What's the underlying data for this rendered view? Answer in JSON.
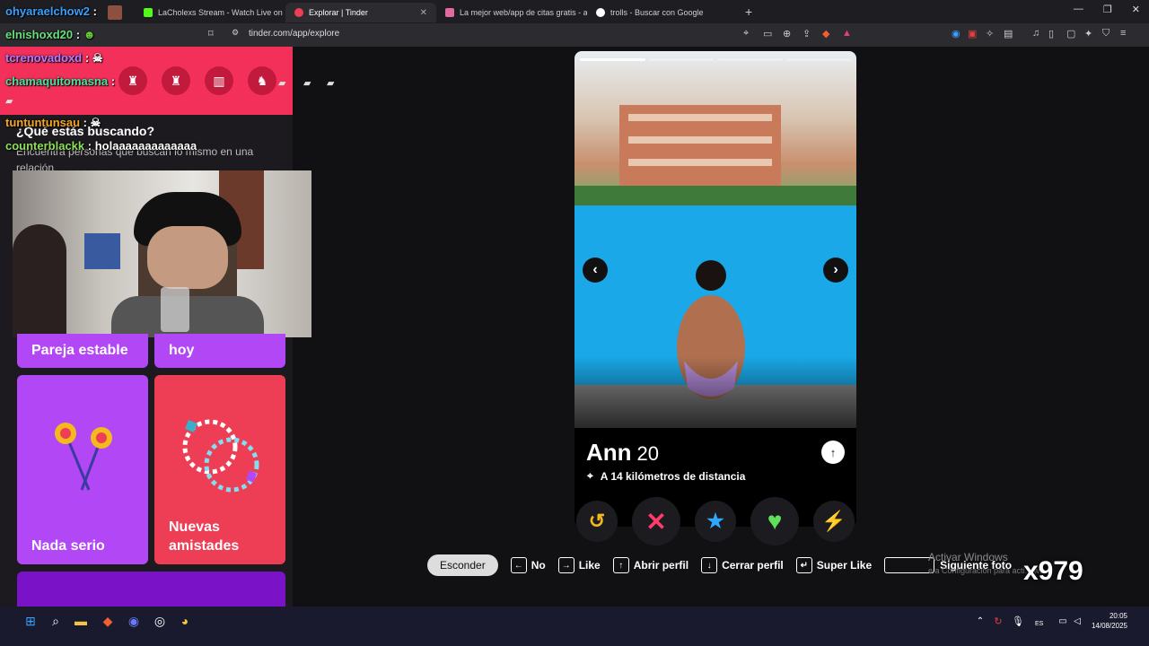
{
  "browser": {
    "tabs": [
      {
        "label": "",
        "active": false
      },
      {
        "label": "LaCholexs Stream - Watch Live on Ki",
        "active": false
      },
      {
        "label": "Explorar | Tinder",
        "active": true
      },
      {
        "label": "La mejor web/app de citas gratis - ar",
        "active": false
      },
      {
        "label": "trolls - Buscar con Google",
        "active": false
      }
    ],
    "new_tab": "+",
    "url": "tinder.com/app/explore"
  },
  "chat": {
    "lines": [
      {
        "user": "ohyaraelchow2",
        "message": ":"
      },
      {
        "user": "elnishoxd20",
        "message": ":"
      },
      {
        "user": "tcrenovadoxd",
        "message": ":"
      },
      {
        "user": "chamaquitomasna",
        "message": ":"
      },
      {
        "user": "tuntuntunsau",
        "message": ":"
      },
      {
        "user": "counterblackk",
        "message": ": holaaaaaaaaaaaaa"
      }
    ],
    "colors": {
      "ohyaraelchow2": "#3aa0ff",
      "elnishoxd20": "#66e07a",
      "tcrenovadoxd": "#b57cff",
      "chamaquitomasna": "#4ee0a0",
      "tuntuntunsau": "#f5a623",
      "counterblackk": "#8ee05a"
    }
  },
  "explore": {
    "heading": "¿Qué estás buscando?",
    "subheading": "Encuentra personas que buscan lo mismo en una relación",
    "cards": [
      {
        "label": "Pareja estable"
      },
      {
        "label": "hoy"
      },
      {
        "label": "Nada serio"
      },
      {
        "label": "Nuevas amistades"
      }
    ]
  },
  "profile": {
    "name": "Ann",
    "age": "20",
    "distance": "A 14 kilómetros de distancia",
    "photo_index": 1,
    "photo_count": 4
  },
  "actions": {
    "rewind": "↺",
    "nope": "✕",
    "superlike": "★",
    "like": "♥",
    "boost": "⚡"
  },
  "shortcuts": {
    "hide": "Esconder",
    "no": "No",
    "like": "Like",
    "open": "Abrir perfil",
    "close": "Cerrar perfil",
    "superlike": "Super Like",
    "next_photo": "Siguiente foto"
  },
  "os": {
    "watermark_title": "Activar Windows",
    "watermark_sub": "e a Configuración para acti... ws.",
    "overlay_logo": "x979",
    "lang": "ES",
    "time": "20:05",
    "date": "14/08/2025"
  },
  "colors": {
    "tinder_red": "#ee3e56",
    "tinder_purple": "#b247f5",
    "stream_banner": "#f2305a",
    "nope": "#ff3b6b",
    "superlike": "#2fa8ff",
    "like": "#5ee05a",
    "boost": "#b247f5",
    "rewind": "#f5b91e"
  }
}
